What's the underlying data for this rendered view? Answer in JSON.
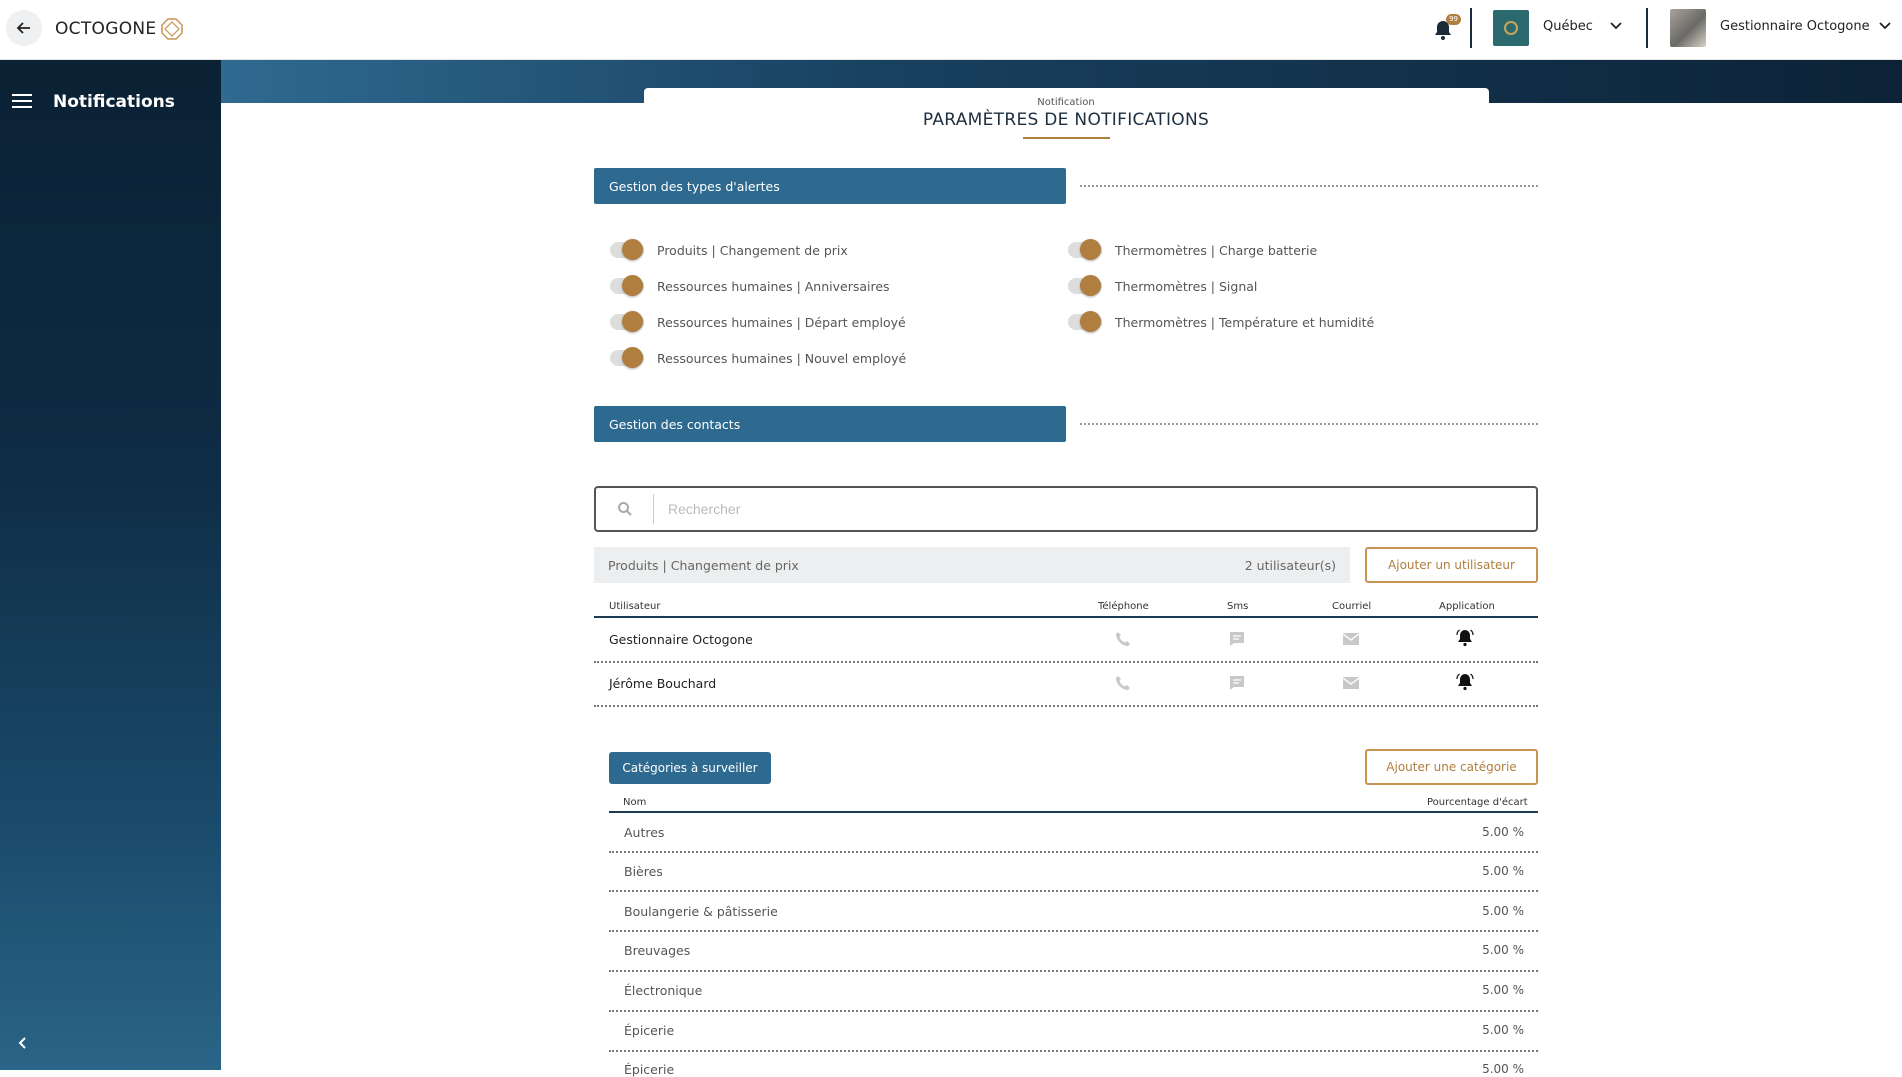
{
  "topbar": {
    "brand": "OCTOGONE",
    "notification_count": "99",
    "store": "Québec",
    "user": "Gestionnaire Octogone"
  },
  "sidebar": {
    "title": "Notifications"
  },
  "page": {
    "eyebrow": "Notification",
    "title": "PARAMÈTRES DE NOTIFICATIONS"
  },
  "alerts": {
    "header": "Gestion des types d'alertes",
    "left": [
      {
        "label": "Produits | Changement de prix",
        "on": true
      },
      {
        "label": "Ressources humaines | Anniversaires",
        "on": true
      },
      {
        "label": "Ressources humaines | Départ employé",
        "on": true
      },
      {
        "label": "Ressources humaines | Nouvel employé",
        "on": true
      }
    ],
    "right": [
      {
        "label": "Thermomètres | Charge batterie",
        "on": true
      },
      {
        "label": "Thermomètres | Signal",
        "on": true
      },
      {
        "label": "Thermomètres | Température et humidité",
        "on": true
      }
    ]
  },
  "contacts": {
    "header": "Gestion des contacts",
    "search_placeholder": "Rechercher",
    "filter_label": "Produits | Changement de prix",
    "user_count": "2 utilisateur(s)",
    "add_user_label": "Ajouter un utilisateur",
    "columns": [
      "Utilisateur",
      "Téléphone",
      "Sms",
      "Courriel",
      "Application"
    ],
    "users": [
      {
        "name": "Gestionnaire Octogone"
      },
      {
        "name": "Jérôme Bouchard"
      }
    ]
  },
  "categories": {
    "header_button": "Catégories à surveiller",
    "add_label": "Ajouter une catégorie",
    "col_name": "Nom",
    "col_pct": "Pourcentage d'écart",
    "rows": [
      {
        "name": "Autres",
        "pct": "5.00 %"
      },
      {
        "name": "Bières",
        "pct": "5.00 %"
      },
      {
        "name": "Boulangerie & pâtisserie",
        "pct": "5.00 %"
      },
      {
        "name": "Breuvages",
        "pct": "5.00 %"
      },
      {
        "name": "Électronique",
        "pct": "5.00 %"
      },
      {
        "name": "Épicerie",
        "pct": "5.00 %"
      },
      {
        "name": "Épicerie",
        "pct": "5.00 %"
      }
    ]
  }
}
